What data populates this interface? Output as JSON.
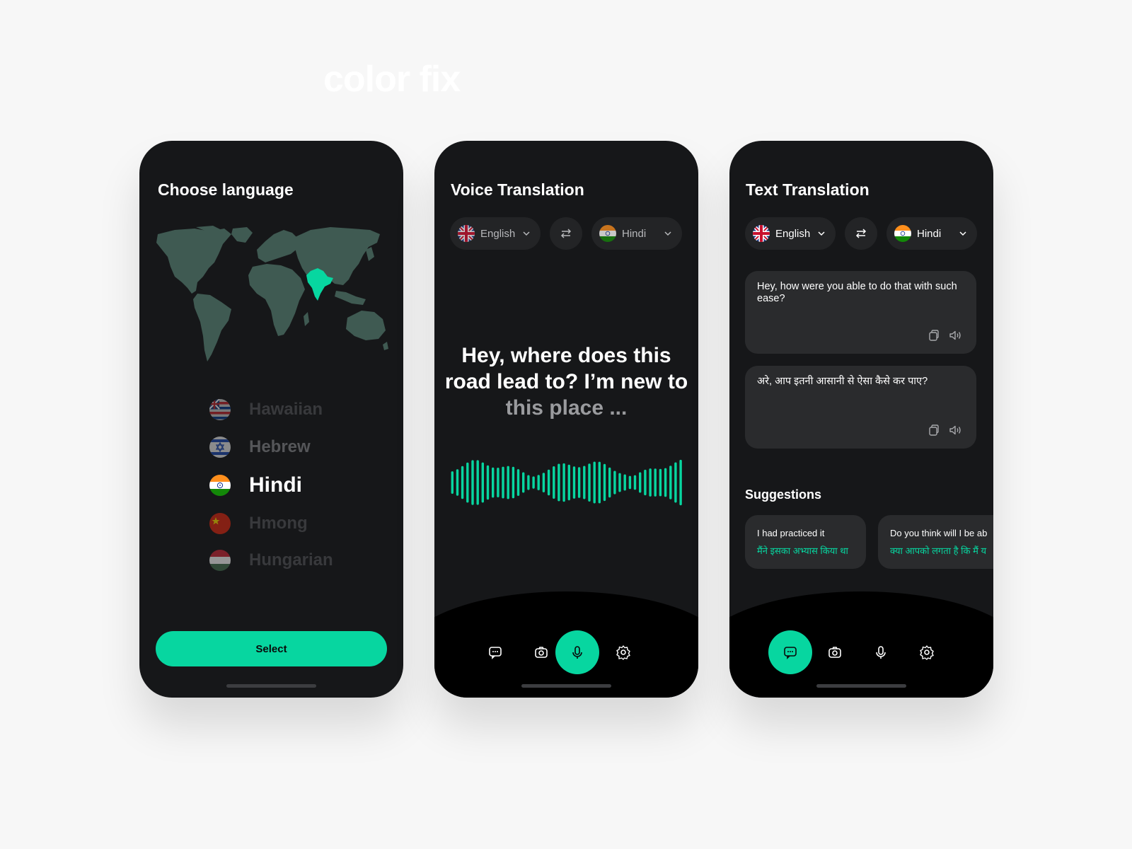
{
  "heading": "color fix",
  "colors": {
    "accent": "#07d6a0",
    "map": "#3f5a52",
    "highlight": "#07d6a0"
  },
  "screen1": {
    "title": "Choose language",
    "languages": [
      {
        "name": "Hawaiian",
        "flag": "hawaii-flag-icon"
      },
      {
        "name": "Hebrew",
        "flag": "israel-flag-icon"
      },
      {
        "name": "Hindi",
        "flag": "india-flag-icon",
        "selected": true
      },
      {
        "name": "Hmong",
        "flag": "china-flag-icon"
      },
      {
        "name": "Hungarian",
        "flag": "hungary-flag-icon"
      }
    ],
    "select_label": "Select"
  },
  "screen2": {
    "title": "Voice Translation",
    "source_lang": "English",
    "target_lang": "Hindi",
    "transcript_main": "Hey, where does this road lead to? I’m new to ",
    "transcript_dim": "this place ..."
  },
  "screen3": {
    "title": "Text Translation",
    "source_lang": "English",
    "target_lang": "Hindi",
    "source_text": "Hey, how were you able to do that with such ease?",
    "translated_text": "अरे, आप इतनी आसानी से ऐसा कैसे कर पाए?",
    "suggestions_title": "Suggestions",
    "suggestions": [
      {
        "text": "I had practiced it",
        "translation": "मैंने इसका अभ्यास किया था"
      },
      {
        "text": "Do you think will I be ab",
        "translation": "क्या आपको लगता है कि मैं य"
      }
    ]
  },
  "nav_icons": [
    "chat-icon",
    "camera-icon",
    "microphone-icon",
    "settings-icon"
  ]
}
